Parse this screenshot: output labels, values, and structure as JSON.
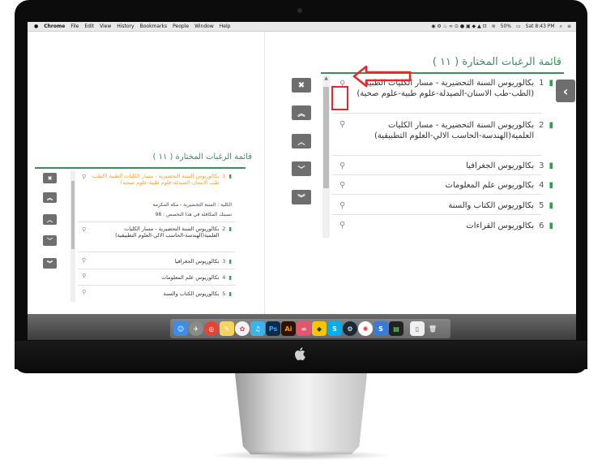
{
  "menubar": {
    "apple": "",
    "items": [
      "Chrome",
      "File",
      "Edit",
      "View",
      "History",
      "Bookmarks",
      "People",
      "Window",
      "Help"
    ],
    "battery": "50%",
    "clock": "Sat 8:43 PM"
  },
  "big_panel": {
    "title": "قائمة الرغبات المختارة ( ١١ )",
    "rows": [
      {
        "num": "1",
        "text": "بكالوريوس السنة التحضيرية - مسار الكليات الطبية (الطب-طب الاسنان-الصيدلة-علوم طبية-علوم صحية)"
      },
      {
        "num": "2",
        "text": "بكالوريوس السنة التحضيرية - مسار الكليات العلمية(الهندسة-الحاسب الالي-العلوم التطبيقية)"
      },
      {
        "num": "3",
        "text": "بكالوريوس الجغرافيا"
      },
      {
        "num": "4",
        "text": "بكالوريوس علم المعلومات"
      },
      {
        "num": "5",
        "text": "بكالوريوس الكتاب والسنة"
      },
      {
        "num": "6",
        "text": "بكالوريوس القراءات"
      }
    ]
  },
  "small_panel": {
    "title": "قائمة الرغبات المختارة ( ١١ )",
    "rows": [
      {
        "num": "1",
        "text": "بكالوريوس السنة التحضيرية - مسار الكليات الطبية (الطب-طب الاسنان-الصيدلة-علوم طبية-علوم صحية)"
      },
      {
        "num": "2",
        "text": "بكالوريوس السنة التحضيرية - مسار الكليات العلمية(الهندسة-الحاسب الالي-العلوم التطبيقية)"
      },
      {
        "num": "3",
        "text": "بكالوريوس الجغرافيا"
      },
      {
        "num": "4",
        "text": "بكالوريوس علم المعلومات"
      },
      {
        "num": "5",
        "text": "بكالوريوس الكتاب والسنة"
      }
    ],
    "detail": {
      "college": "الكلية : السنة التحضيرية - مكة المكرمة",
      "ratio": "نسبتك المكافئة في هذا التخصص : 98"
    }
  },
  "icons": {
    "remove": "✖",
    "to_top": "⇈",
    "up": "⌃",
    "down": "⌄",
    "to_bottom": "⇊",
    "search": "🔍",
    "bookmark": "▶",
    "back": "‹"
  },
  "colors": {
    "accent_green": "#3d8e5a",
    "highlight_orange": "#e8a33d",
    "arrow_red": "#e8262b",
    "button_gray": "#6e6e6e"
  },
  "dock_icons": [
    "finder",
    "launchpad",
    "chrome",
    "notes",
    "photos",
    "bird",
    "photoshop",
    "illustrator",
    "link",
    "sketch",
    "skype",
    "steam",
    "pinwheel",
    "activity",
    "terminal",
    "preview",
    "trash"
  ]
}
